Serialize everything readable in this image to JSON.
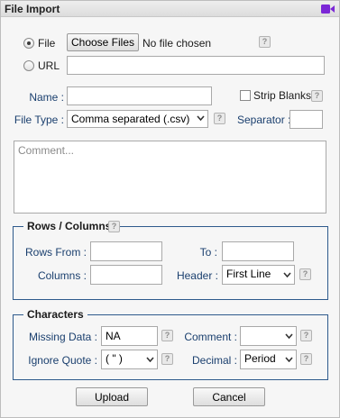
{
  "window": {
    "title": "File Import",
    "accent_color": "#7b27d6",
    "icon": "video-camera-icon"
  },
  "source": {
    "file_radio_label": "File",
    "url_radio_label": "URL",
    "selected": "File",
    "choose_button_label": "Choose Files",
    "no_file_text": "No file chosen",
    "url_value": ""
  },
  "options": {
    "name_label": "Name :",
    "name_value": "",
    "strip_blanks_label": "Strip Blanks",
    "strip_blanks_checked": false,
    "file_type_label": "File Type :",
    "file_type_value": "Comma separated (.csv)",
    "separator_label": "Separator :",
    "separator_value": ""
  },
  "comment": {
    "placeholder": "Comment..."
  },
  "rows_columns": {
    "legend": "Rows / Columns",
    "rows_from_label": "Rows From :",
    "rows_from_value": "",
    "to_label": "To :",
    "to_value": "",
    "columns_label": "Columns :",
    "columns_value": "",
    "header_label": "Header :",
    "header_value": "First Line"
  },
  "characters": {
    "legend": "Characters",
    "missing_data_label": "Missing Data :",
    "missing_data_value": "NA",
    "comment_label": "Comment :",
    "comment_value": "",
    "ignore_quote_label": "Ignore Quote :",
    "ignore_quote_value": "( \" )",
    "decimal_label": "Decimal :",
    "decimal_value": "Period"
  },
  "help_glyph": "?",
  "buttons": {
    "upload_label": "Upload",
    "cancel_label": "Cancel"
  },
  "colors": {
    "fieldset_border": "#2e5a8c",
    "label_blue": "#1a3f6e"
  }
}
